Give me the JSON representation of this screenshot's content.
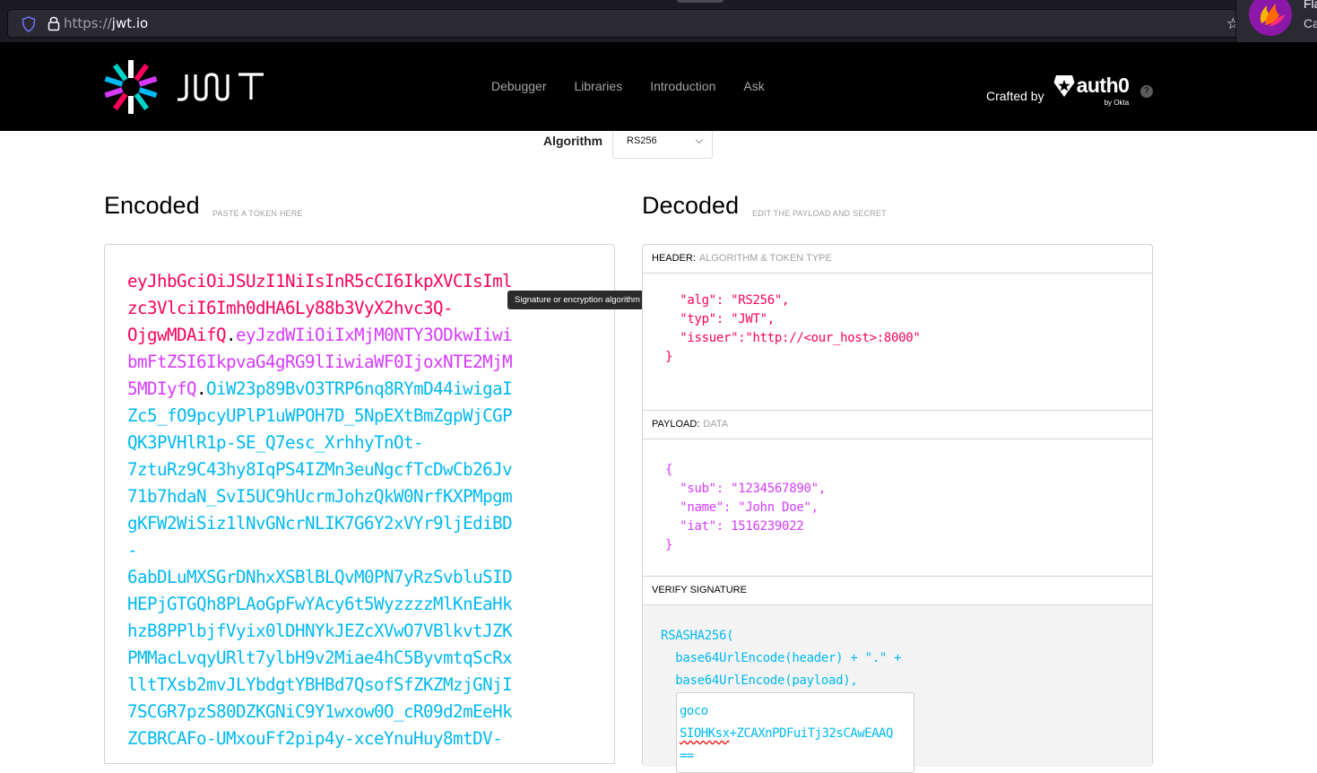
{
  "browser": {
    "url_scheme": "https://",
    "url_host": "jwt.io",
    "extension_popup": {
      "title": "Fla",
      "subtitle": "Ca"
    }
  },
  "nav": {
    "logo_text": "JWT",
    "links": [
      "Debugger",
      "Libraries",
      "Introduction",
      "Ask"
    ],
    "crafted_by": "Crafted by",
    "brand": "auth0",
    "brand_sub": "by Okta",
    "help": "?"
  },
  "algorithm": {
    "label": "Algorithm",
    "selected": "RS256"
  },
  "encoded": {
    "title": "Encoded",
    "subtitle": "PASTE A TOKEN HERE",
    "lines": [
      [
        {
          "t": "eyJhbGciOiJSUzI1NiIsInR5cCI6IkpXVCIsIml",
          "c": "h"
        }
      ],
      [
        {
          "t": "zc3VlciI6Imh0dHA6Ly88b3VyX2hvc3Q-",
          "c": "h"
        }
      ],
      [
        {
          "t": "OjgwMDAifQ",
          "c": "h"
        },
        {
          "t": ".",
          "c": "d"
        },
        {
          "t": "eyJzdWIiOiIxMjM0NTY3ODkwIiwi",
          "c": "p"
        }
      ],
      [
        {
          "t": "bmFtZSI6IkpvaG4gRG9lIiwiaWF0IjoxNTE2MjM",
          "c": "p"
        }
      ],
      [
        {
          "t": "5MDIyfQ",
          "c": "p"
        },
        {
          "t": ".",
          "c": "d"
        },
        {
          "t": "OiW23p89BvO3TRP6nq8RYmD44iwigaI",
          "c": "s"
        }
      ],
      [
        {
          "t": "Zc5_fO9pcyUPlP1uWPOH7D_5NpEXtBmZgpWjCGP",
          "c": "s"
        }
      ],
      [
        {
          "t": "QK3PVHlR1p-SE_Q7esc_XrhhyTnOt-",
          "c": "s"
        }
      ],
      [
        {
          "t": "7ztuRz9C43hy8IqPS4IZMn3euNgcfTcDwCb26Jv",
          "c": "s"
        }
      ],
      [
        {
          "t": "71b7hdaN_SvI5UC9hUcrmJohzQkW0NrfKXPMpgm",
          "c": "s"
        }
      ],
      [
        {
          "t": "gKFW2WiSiz1lNvGNcrNLIK7G6Y2xVYr9ljEdiBD",
          "c": "s"
        }
      ],
      [
        {
          "t": "-",
          "c": "s"
        }
      ],
      [
        {
          "t": "6abDLuMXSGrDNhxXSBlBLQvM0PN7yRzSvbluSID",
          "c": "s"
        }
      ],
      [
        {
          "t": "HEPjGTGQh8PLAoGpFwYAcy6t5WyzzzzMlKnEaHk",
          "c": "s"
        }
      ],
      [
        {
          "t": "hzB8PPlbjfVyix0lDHNYkJEZcXVwO7VBlkvtJZK",
          "c": "s"
        }
      ],
      [
        {
          "t": "PMMacLvqyURlt7ylbH9v2Miae4hC5ByvmtqScRx",
          "c": "s"
        }
      ],
      [
        {
          "t": "lltTXsb2mvJLYbdgtYBHBd7QsofSfZKZMzjGNjI",
          "c": "s"
        }
      ],
      [
        {
          "t": "7SCGR7pzS80DZKGNiC9Y1wxow0O_cR09d2mEeHk",
          "c": "s"
        }
      ],
      [
        {
          "t": "ZCBRCAFo-UMxouFf2pip4y-xceYnuHuy8mtDV-",
          "c": "s"
        }
      ]
    ]
  },
  "tooltip": "Signature or encryption algorithm",
  "decoded": {
    "title": "Decoded",
    "subtitle": "EDIT THE PAYLOAD AND SECRET",
    "header_section": {
      "label": "HEADER:",
      "sub": "ALGORITHM & TOKEN TYPE",
      "code": "  \"alg\": \"RS256\",\n  \"typ\": \"JWT\",\n  \"issuer\":\"http://<our_host>:8000\"\n}"
    },
    "payload_section": {
      "label": "PAYLOAD:",
      "sub": "DATA",
      "code": "{\n  \"sub\": \"1234567890\",\n  \"name\": \"John Doe\",\n  \"iat\": 1516239022\n}"
    },
    "verify_section": {
      "label": "VERIFY SIGNATURE",
      "code": "RSASHA256(\n  base64UrlEncode(header) + \".\" +\n  base64UrlEncode(payload),",
      "key_line1": "goco",
      "key_line2_err": "SIOHKsx",
      "key_line2_rest": "+ZCAXnPDFuiTj32sCAwEAAQ",
      "key_line3": "=="
    }
  },
  "colors": {
    "header": "#fb015b",
    "payload": "#d63aff",
    "signature": "#00b9f1"
  }
}
